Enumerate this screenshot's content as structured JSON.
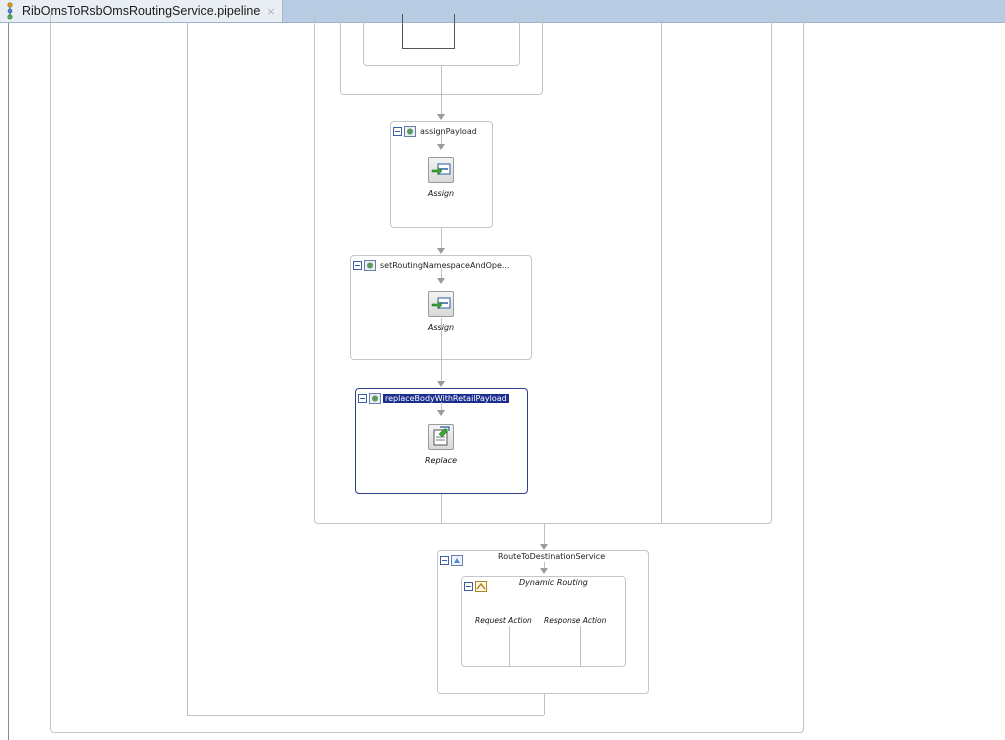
{
  "tab": {
    "label": "RibOmsToRsbOmsRoutingService.pipeline",
    "close_glyph": "×",
    "icon": "pipeline-file-icon"
  },
  "stages": {
    "assign_payload": {
      "title": "assignPayload",
      "action_label": "Assign",
      "icon": "assign-action-icon"
    },
    "set_routing": {
      "title": "setRoutingNamespaceAndOpe...",
      "action_label": "Assign",
      "icon": "assign-action-icon"
    },
    "replace_body": {
      "title": "replaceBodyWithRetailPayload",
      "action_label": "Replace",
      "icon": "replace-action-icon",
      "selected": true
    }
  },
  "route": {
    "title": "RouteToDestinationService",
    "dynamic_routing": {
      "title": "Dynamic Routing",
      "request_action": "Request Action",
      "response_action": "Response Action"
    }
  },
  "colors": {
    "tabbar": "#b8cde4",
    "selection": "#1b2d8f",
    "border": "#c4c4c4"
  }
}
